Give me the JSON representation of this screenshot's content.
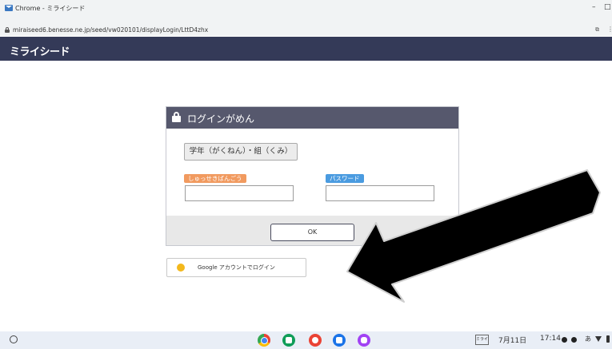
{
  "browser": {
    "tab_title": "Chrome - ミライシード",
    "url": "miraiseed6.benesse.ne.jp/seed/vw020101/displayLogin/LttD4zhx",
    "window_minimize": "–",
    "window_maximize": "□",
    "extension_icon": "puzzle-icon"
  },
  "app": {
    "logo": "ミライシード",
    "header_color": "#343a58"
  },
  "login": {
    "title": "ログインがめん",
    "grade_button": "学年（がくねん）・組（くみ）",
    "id_label": "しゅっせきばんごう",
    "password_label": "パスワード",
    "id_value": "",
    "password_value": "",
    "ok_button": "OK",
    "google_button": "Google アカウントでログイン"
  },
  "colors": {
    "panel_header": "#56586d",
    "id_label_bg": "#f19a5f",
    "password_label_bg": "#4a9be0",
    "google_dot": "#f3b81c"
  },
  "shelf": {
    "apps": [
      "chrome-icon",
      "meet-icon",
      "cast-icon",
      "files-icon",
      "messages-icon"
    ],
    "ime_icon": "ミライ",
    "date": "7月11日",
    "time": "17:14",
    "ime_mode": "あ"
  }
}
